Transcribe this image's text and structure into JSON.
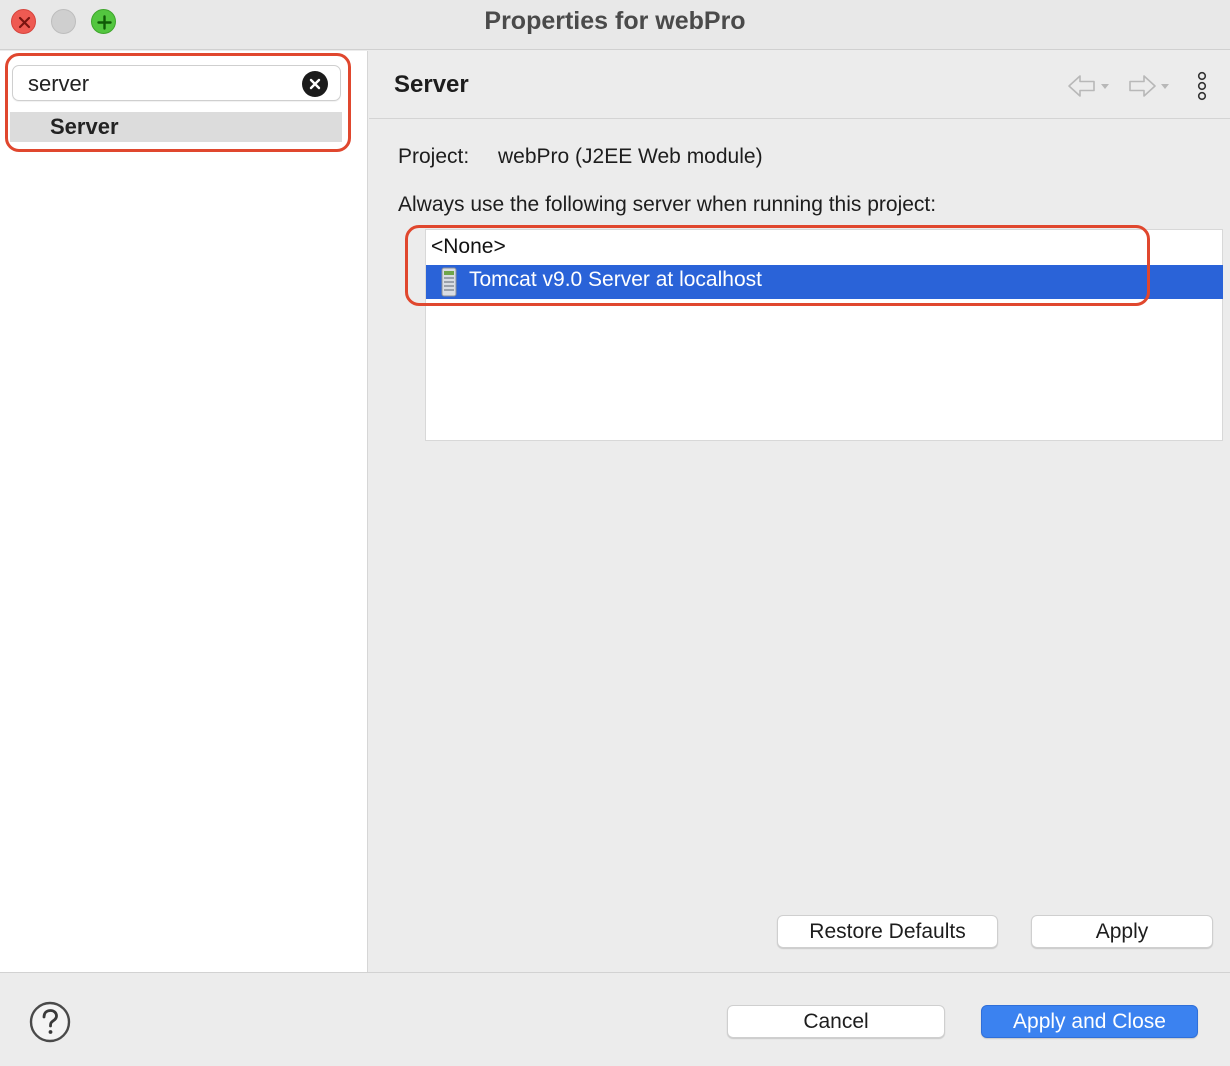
{
  "window": {
    "title": "Properties for webPro"
  },
  "sidebar": {
    "filter_value": "server",
    "tree_items": [
      {
        "label": "Server",
        "selected": true
      }
    ]
  },
  "page": {
    "title": "Server",
    "project_label": "Project:",
    "project_value": "webPro (J2EE Web module)",
    "server_prompt": "Always use the following server when running this project:",
    "servers": [
      {
        "label": "<None>",
        "selected": false
      },
      {
        "label": "Tomcat v9.0 Server at localhost",
        "selected": true,
        "icon": "server-icon"
      }
    ]
  },
  "buttons": {
    "restore_defaults": "Restore Defaults",
    "apply": "Apply",
    "cancel": "Cancel",
    "apply_and_close": "Apply and Close"
  },
  "colors": {
    "selection": "#2a63d8",
    "primary_button": "#3b82f0",
    "annotation_outline": "#e0472e"
  }
}
